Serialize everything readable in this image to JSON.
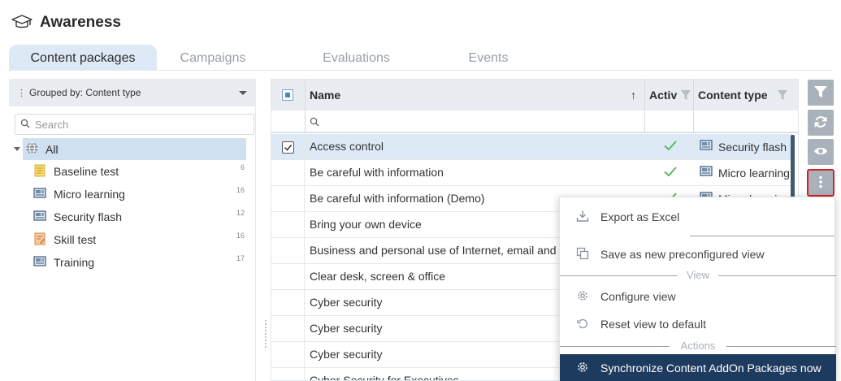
{
  "app": {
    "title": "Awareness",
    "title_icon": "graduation-cap-icon"
  },
  "tabs": [
    {
      "label": "Content packages",
      "active": true
    },
    {
      "label": "Campaigns",
      "active": false
    },
    {
      "label": "Evaluations",
      "active": false
    },
    {
      "label": "Events",
      "active": false
    }
  ],
  "sidebar": {
    "group_by_label": "Grouped by: Content type",
    "search_placeholder": "Search",
    "all_label": "All",
    "items": [
      {
        "label": "Baseline test",
        "count": "6",
        "icon": "document-icon"
      },
      {
        "label": "Micro learning",
        "count": "16",
        "icon": "presentation-icon"
      },
      {
        "label": "Security flash",
        "count": "12",
        "icon": "presentation-icon"
      },
      {
        "label": "Skill test",
        "count": "16",
        "icon": "edit-document-icon"
      },
      {
        "label": "Training",
        "count": "17",
        "icon": "presentation-icon"
      }
    ]
  },
  "grid": {
    "columns": {
      "name": "Name",
      "active": "Activ",
      "content_type": "Content type"
    },
    "rows": [
      {
        "name": "Access control",
        "active": true,
        "content_type": "Security flash",
        "selected": true
      },
      {
        "name": "Be careful with information",
        "active": true,
        "content_type": "Micro learning",
        "selected": false
      },
      {
        "name": "Be careful with information (Demo)",
        "active": true,
        "content_type": "Micro learning",
        "selected": false
      },
      {
        "name": "Bring your own device",
        "active": false,
        "content_type": "",
        "selected": false
      },
      {
        "name": "Business and personal use of Internet, email and social media",
        "active": false,
        "content_type": "",
        "selected": false
      },
      {
        "name": "Clear desk, screen & office",
        "active": false,
        "content_type": "",
        "selected": false
      },
      {
        "name": "Cyber security",
        "active": false,
        "content_type": "",
        "selected": false
      },
      {
        "name": "Cyber security",
        "active": false,
        "content_type": "",
        "selected": false
      },
      {
        "name": "Cyber security",
        "active": false,
        "content_type": "",
        "selected": false
      },
      {
        "name": "Cyber Security for Executives",
        "active": false,
        "content_type": "",
        "selected": false
      }
    ]
  },
  "context_menu": {
    "export_excel": "Export as Excel",
    "save_view": "Save as new preconfigured view",
    "section_view": "View",
    "configure_view": "Configure view",
    "reset_view": "Reset view to default",
    "section_actions": "Actions",
    "sync_packages": "Synchronize Content AddOn Packages now"
  },
  "colors": {
    "accent": "#1d3a5f",
    "selected_row": "#ddeaf6",
    "check_green": "#5cb85c",
    "toolbar_button": "#a9b2bb",
    "highlight_border": "#d9202a"
  }
}
